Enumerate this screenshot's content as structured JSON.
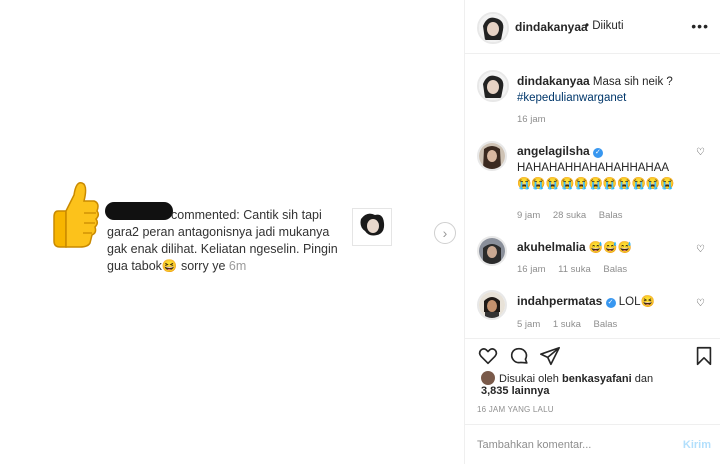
{
  "post": {
    "comment_text": "commented: Cantik sih tapi gara2 peran antagonisnya jadi mukanya gak enak dilihat. Keliatan ngeselin. Pingin gua tabok😆 sorry ye",
    "comment_time": "6m",
    "next_icon": "chevron-right-icon"
  },
  "header": {
    "username": "dindakanyaa",
    "follow_status": "• Diikuti",
    "more_label": "•••"
  },
  "caption": {
    "username": "dindakanyaa",
    "text": "Masa sih neik ?",
    "hashtag": "#kepedulianwarganet",
    "time": "16 jam"
  },
  "comments": [
    {
      "username": "angelagilsha",
      "verified": true,
      "text": "HAHAHAHHAHAHAHHAHAA😭😭😭😭😭😭😭😭😭😭😭",
      "time": "9 jam",
      "likes": "28 suka",
      "reply": "Balas"
    },
    {
      "username": "akuhelmalia",
      "verified": false,
      "text": "😅😅😅",
      "time": "16 jam",
      "likes": "11 suka",
      "reply": "Balas"
    },
    {
      "username": "indahpermatas",
      "verified": true,
      "text": "LOL😆",
      "time": "5 jam",
      "likes": "1 suka",
      "reply": "Balas"
    }
  ],
  "likes": {
    "prefix": "Disukai oleh",
    "user": "benkasyafani",
    "conj": "dan",
    "count": "3,835 lainnya"
  },
  "post_date": "16 JAM YANG LALU",
  "composer": {
    "placeholder": "Tambahkan komentar...",
    "send_label": "Kirim"
  },
  "colors": {
    "link": "#00376b",
    "verified": "#3897f0",
    "muted": "#8e8e8e",
    "send_disabled": "#b2dffc"
  }
}
